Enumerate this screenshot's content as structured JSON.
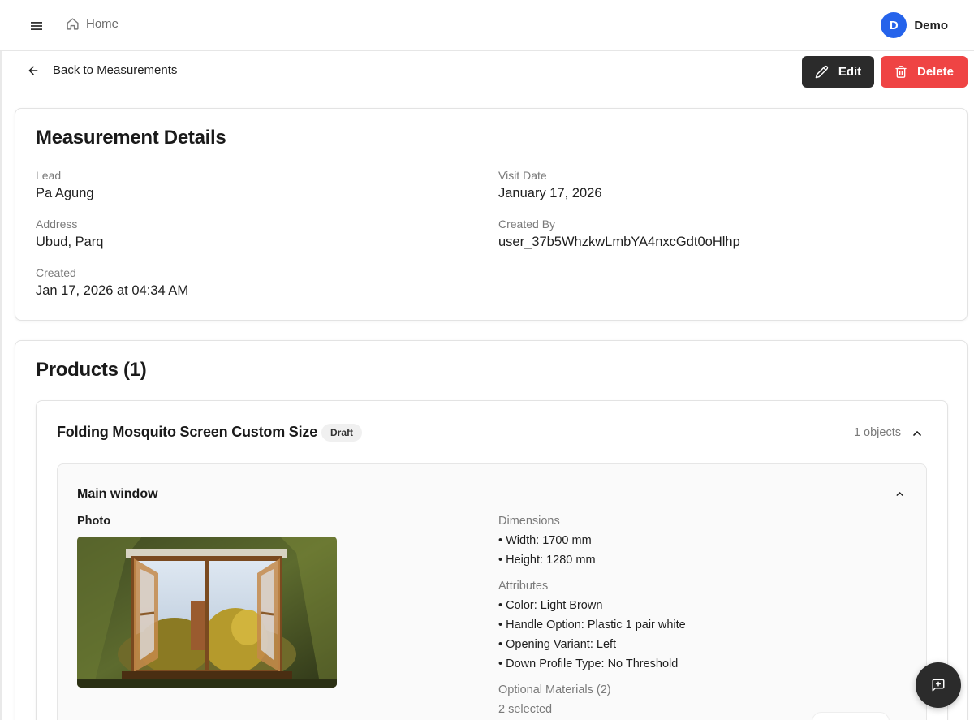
{
  "header": {
    "breadcrumb_home": "Home",
    "user_initial": "D",
    "user_name": "Demo",
    "avatar_color": "#2563eb"
  },
  "actions": {
    "back_label": "Back to Measurements",
    "edit_label": "Edit",
    "delete_label": "Delete"
  },
  "details": {
    "title": "Measurement Details",
    "lead_label": "Lead",
    "lead_value": "Pa Agung",
    "visit_date_label": "Visit Date",
    "visit_date_value": "January 17, 2026",
    "address_label": "Address",
    "address_value": "Ubud, Parq",
    "created_by_label": "Created By",
    "created_by_value": "user_37b5WhzkwLmbYA4nxcGdt0oHlhp",
    "created_label": "Created",
    "created_value": "Jan 17, 2026 at 04:34 AM"
  },
  "products": {
    "title": "Products (1)",
    "items": [
      {
        "name": "Folding Mosquito Screen Custom Size",
        "status": "Draft",
        "object_count": "1 objects",
        "objects": [
          {
            "name": "Main window",
            "photo_label": "Photo",
            "dimensions_label": "Dimensions",
            "dimensions": [
              "• Width: 1700 mm",
              "• Height: 1280 mm"
            ],
            "attributes_label": "Attributes",
            "attributes": [
              "• Color: Light Brown",
              "• Handle Option: Plastic 1 pair white",
              "• Opening Variant: Left",
              "• Down Profile Type: No Threshold"
            ],
            "optional_label": "Optional Materials (2)",
            "optional_value": "2 selected"
          }
        ]
      }
    ]
  },
  "colors": {
    "edit_button": "#2b2b2b",
    "delete_button": "#ef4444",
    "fab": "#2b2b2b"
  },
  "icons": [
    "menu-icon",
    "home-icon",
    "arrow-left-icon",
    "pencil-icon",
    "trash-icon",
    "chevron-up-icon",
    "message-plus-icon"
  ]
}
